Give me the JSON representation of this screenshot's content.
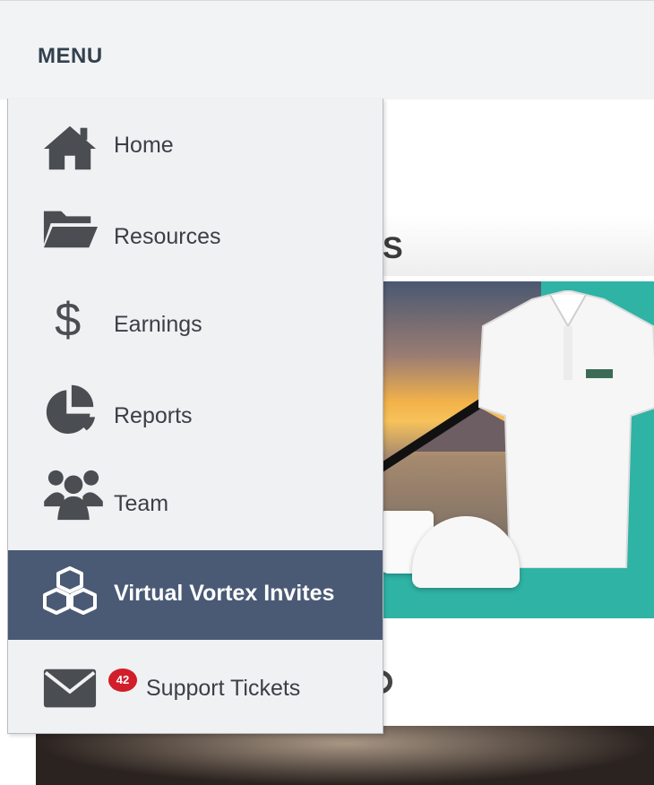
{
  "header": {
    "title": "MENU"
  },
  "menu": {
    "items": [
      {
        "label": "Home",
        "icon": "home-icon"
      },
      {
        "label": "Resources",
        "icon": "folder-open-icon"
      },
      {
        "label": "Earnings",
        "icon": "dollar-icon"
      },
      {
        "label": "Reports",
        "icon": "pie-chart-icon"
      },
      {
        "label": "Team",
        "icon": "users-icon"
      },
      {
        "label": "Virtual Vortex Invites",
        "icon": "cubes-icon",
        "active": true
      },
      {
        "label": "Support Tickets",
        "icon": "envelope-icon",
        "badge": "42"
      }
    ]
  },
  "colors": {
    "active_bg": "#4a5a75",
    "badge": "#d21d2a",
    "icon": "#4a4d52"
  }
}
